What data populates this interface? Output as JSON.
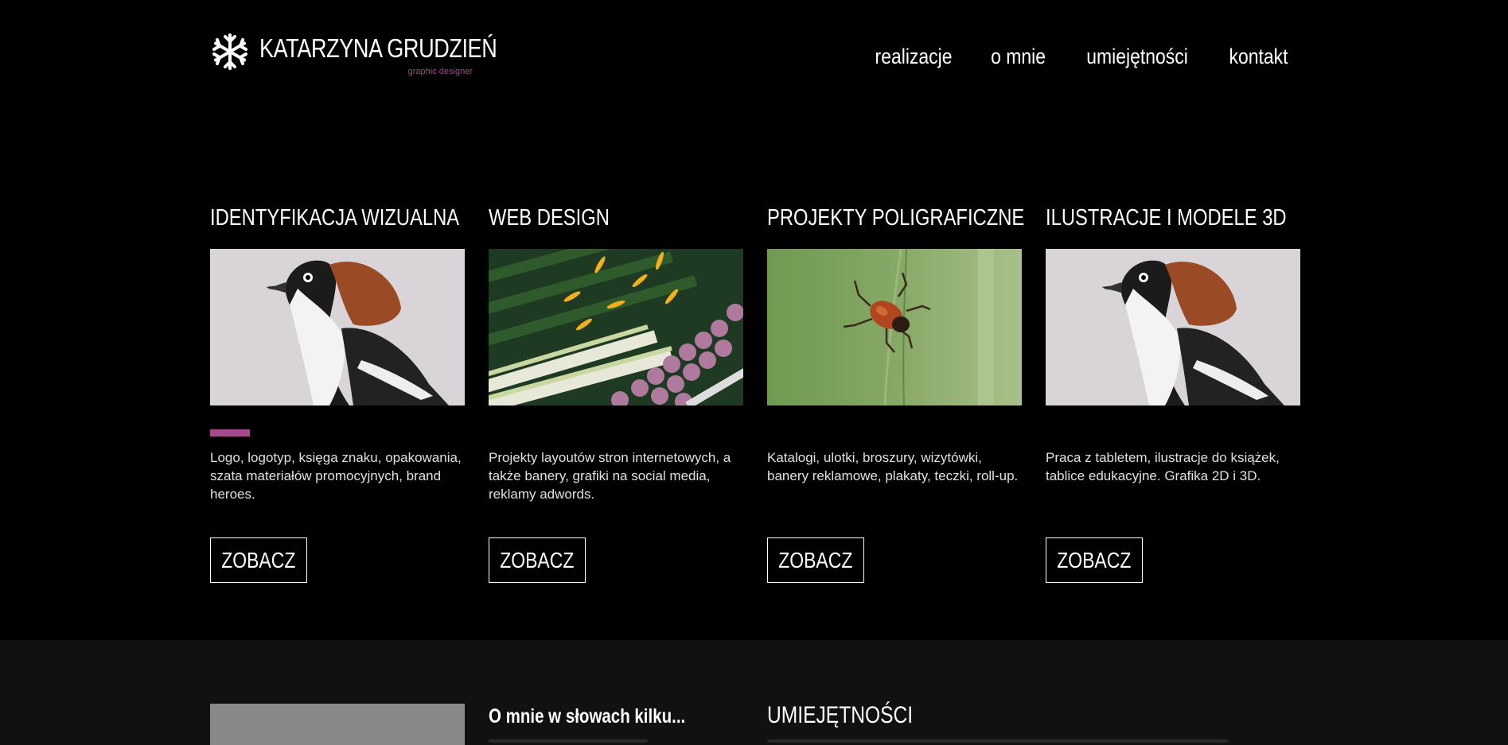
{
  "header": {
    "logo_name": "KATARZYNA GRUDZIEŃ",
    "logo_subtitle": "graphic designer",
    "logo_icon": "snowflake-icon",
    "nav": [
      {
        "label": "realizacje"
      },
      {
        "label": "o mnie"
      },
      {
        "label": "umiejętności"
      },
      {
        "label": "kontakt"
      }
    ]
  },
  "services": [
    {
      "title": "IDENTYFIKACJA WIZUALNA",
      "image": "bird-illustration",
      "description": "Logo, logotyp, księga znaku, opakowania, szata materiałów promocyjnych, brand heroes.",
      "button": "ZOBACZ"
    },
    {
      "title": "WEB DESIGN",
      "image": "vegetables-photo",
      "description": "Projekty layoutów stron internetowych, a także banery, grafiki na social media, reklamy adwords.",
      "button": "ZOBACZ"
    },
    {
      "title": "PROJEKTY POLIGRAFICZNE",
      "image": "beetle-photo",
      "description": "Katalogi, ulotki, broszury, wizytówki, banery reklamowe, plakaty, teczki, roll-up.",
      "button": "ZOBACZ"
    },
    {
      "title": "ILUSTRACJE I MODELE 3D",
      "image": "bird-illustration",
      "description": "Praca z tabletem, ilustracje do książek, tablice edukacyjne. Grafika 2D i 3D.",
      "button": "ZOBACZ"
    }
  ],
  "about": {
    "title": "O mnie w słowach kilku..."
  },
  "skills": {
    "title": "UMIEJĘTNOŚCI"
  },
  "colors": {
    "background": "#000000",
    "accent": "#a54b8d",
    "section_dark": "#111111"
  }
}
